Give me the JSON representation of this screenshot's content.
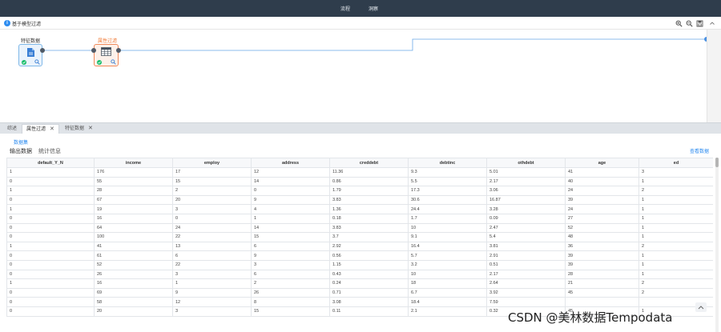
{
  "topbar": {
    "tabs": [
      "流程",
      "洞察"
    ],
    "background": "#2f3d4c"
  },
  "canvas_header": {
    "title": "基于模型过滤"
  },
  "nodes": [
    {
      "label": "特征数据",
      "icon": "file-icon",
      "border": "#7fb8e8"
    },
    {
      "label": "属性过滤",
      "icon": "table-icon",
      "border": "#f0895a",
      "label_color": "#f07c3a"
    }
  ],
  "bottom_tabs": [
    {
      "label": "综述",
      "closable": false
    },
    {
      "label": "属性过滤",
      "closable": true,
      "active": true
    },
    {
      "label": "特征数据",
      "closable": true
    }
  ],
  "panel": {
    "breadcrumb": "数据集",
    "subtabs": [
      "输出数据",
      "统计信息"
    ],
    "view_data": "查看数据"
  },
  "table": {
    "columns": [
      "default_Y_N",
      "income",
      "employ",
      "address",
      "creddebt",
      "debtinc",
      "othdebt",
      "age",
      "ed"
    ],
    "rows": [
      [
        "1",
        "176",
        "17",
        "12",
        "11.36",
        "9.3",
        "5.01",
        "41",
        "3"
      ],
      [
        "0",
        "55",
        "15",
        "14",
        "0.86",
        "5.5",
        "2.17",
        "40",
        "1"
      ],
      [
        "1",
        "28",
        "2",
        "0",
        "1.79",
        "17.3",
        "3.06",
        "24",
        "2"
      ],
      [
        "0",
        "67",
        "20",
        "9",
        "3.83",
        "30.6",
        "16.87",
        "39",
        "1"
      ],
      [
        "1",
        "19",
        "3",
        "4",
        "1.36",
        "24.4",
        "3.28",
        "24",
        "1"
      ],
      [
        "0",
        "16",
        "0",
        "1",
        "0.18",
        "1.7",
        "0.09",
        "27",
        "1"
      ],
      [
        "0",
        "64",
        "24",
        "14",
        "3.83",
        "10",
        "2.47",
        "52",
        "1"
      ],
      [
        "0",
        "100",
        "22",
        "15",
        "3.7",
        "9.1",
        "5.4",
        "48",
        "1"
      ],
      [
        "1",
        "41",
        "13",
        "6",
        "2.92",
        "16.4",
        "3.81",
        "36",
        "2"
      ],
      [
        "0",
        "61",
        "6",
        "9",
        "0.56",
        "5.7",
        "2.91",
        "39",
        "1"
      ],
      [
        "0",
        "52",
        "22",
        "3",
        "1.15",
        "3.2",
        "0.51",
        "39",
        "1"
      ],
      [
        "0",
        "26",
        "3",
        "6",
        "0.43",
        "10",
        "2.17",
        "28",
        "1"
      ],
      [
        "1",
        "16",
        "1",
        "2",
        "0.24",
        "18",
        "2.64",
        "21",
        "2"
      ],
      [
        "0",
        "69",
        "9",
        "26",
        "0.71",
        "6.7",
        "3.92",
        "45",
        "2"
      ],
      [
        "0",
        "58",
        "12",
        "8",
        "3.08",
        "18.4",
        "7.59",
        "",
        ""
      ],
      [
        "0",
        "20",
        "3",
        "15",
        "0.11",
        "2.1",
        "0.32",
        "45",
        "1"
      ]
    ]
  },
  "watermark": "CSDN @美林数据Tempodata",
  "colors": {
    "accent": "#2d8cf0",
    "edge": "#6aa7e8",
    "success": "#19be6b",
    "node_orange": "#f07c3a"
  }
}
